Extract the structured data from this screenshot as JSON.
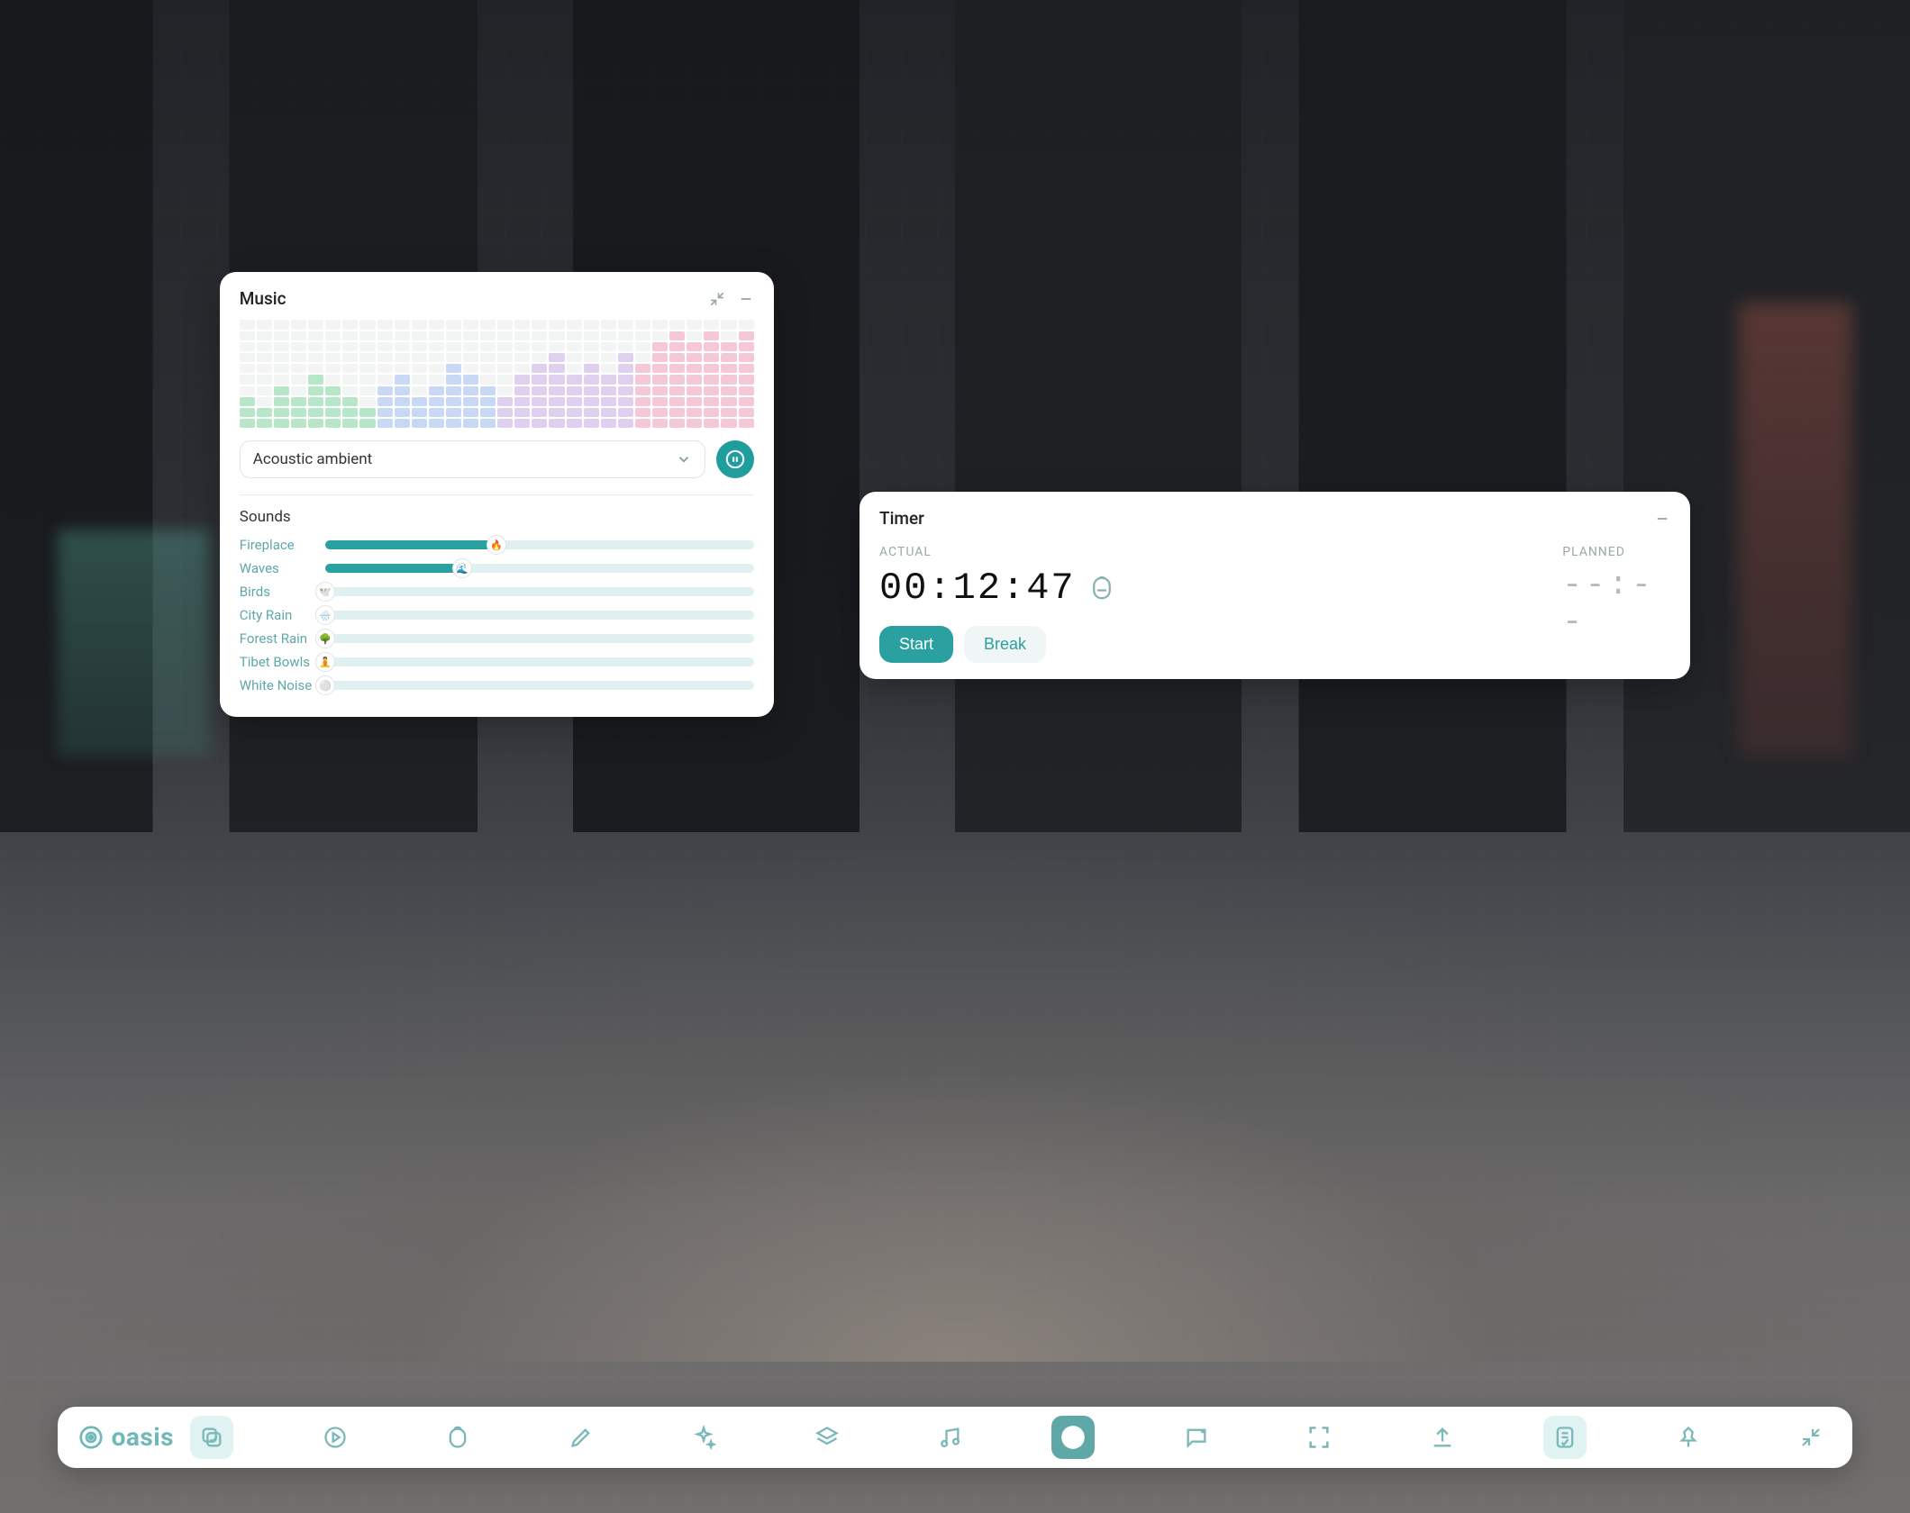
{
  "music": {
    "title": "Music",
    "selected_track": "Acoustic ambient",
    "sounds_title": "Sounds",
    "sounds": [
      {
        "name": "Fireplace",
        "value": 40,
        "emoji": "🔥"
      },
      {
        "name": "Waves",
        "value": 32,
        "emoji": "🌊"
      },
      {
        "name": "Birds",
        "value": 0,
        "emoji": "🕊️"
      },
      {
        "name": "City Rain",
        "value": 0,
        "emoji": "🌧️"
      },
      {
        "name": "Forest Rain",
        "value": 0,
        "emoji": "🌳"
      },
      {
        "name": "Tibet Bowls",
        "value": 0,
        "emoji": "🧘"
      },
      {
        "name": "White Noise",
        "value": 0,
        "emoji": "⚪"
      }
    ],
    "visualizer": {
      "cols": 30,
      "rows": 10,
      "heights": [
        3,
        2,
        4,
        3,
        5,
        4,
        3,
        2,
        4,
        5,
        3,
        4,
        6,
        5,
        4,
        3,
        5,
        6,
        7,
        5,
        6,
        5,
        7,
        6,
        8,
        9,
        8,
        9,
        8,
        9
      ],
      "palette": [
        "#b8e6c8",
        "#c8d8f5",
        "#e0d0f0",
        "#f5c8d8"
      ]
    }
  },
  "timer": {
    "title": "Timer",
    "actual_label": "ACTUAL",
    "planned_label": "PLANNED",
    "actual_time": "00:12:47",
    "planned_time": "--:--",
    "start_label": "Start",
    "break_label": "Break"
  },
  "dock": {
    "logo_text": "oasis",
    "items": [
      {
        "name": "tasks-icon",
        "active": true,
        "filled": false
      },
      {
        "name": "play-icon",
        "active": false,
        "filled": false
      },
      {
        "name": "pomodoro-icon",
        "active": false,
        "filled": false
      },
      {
        "name": "pen-icon",
        "active": false,
        "filled": false
      },
      {
        "name": "sparkle-icon",
        "active": false,
        "filled": false
      },
      {
        "name": "layers-icon",
        "active": false,
        "filled": false
      },
      {
        "name": "music-note-icon",
        "active": false,
        "filled": false
      },
      {
        "name": "spotify-icon",
        "active": false,
        "filled": true
      },
      {
        "name": "chat-icon",
        "active": false,
        "filled": false
      },
      {
        "name": "focus-icon",
        "active": false,
        "filled": false
      },
      {
        "name": "upload-icon",
        "active": false,
        "filled": false
      },
      {
        "name": "notes-icon",
        "active": true,
        "filled": false
      },
      {
        "name": "pin-icon",
        "active": false,
        "filled": false
      },
      {
        "name": "minimize-icon",
        "active": false,
        "filled": false
      }
    ]
  }
}
